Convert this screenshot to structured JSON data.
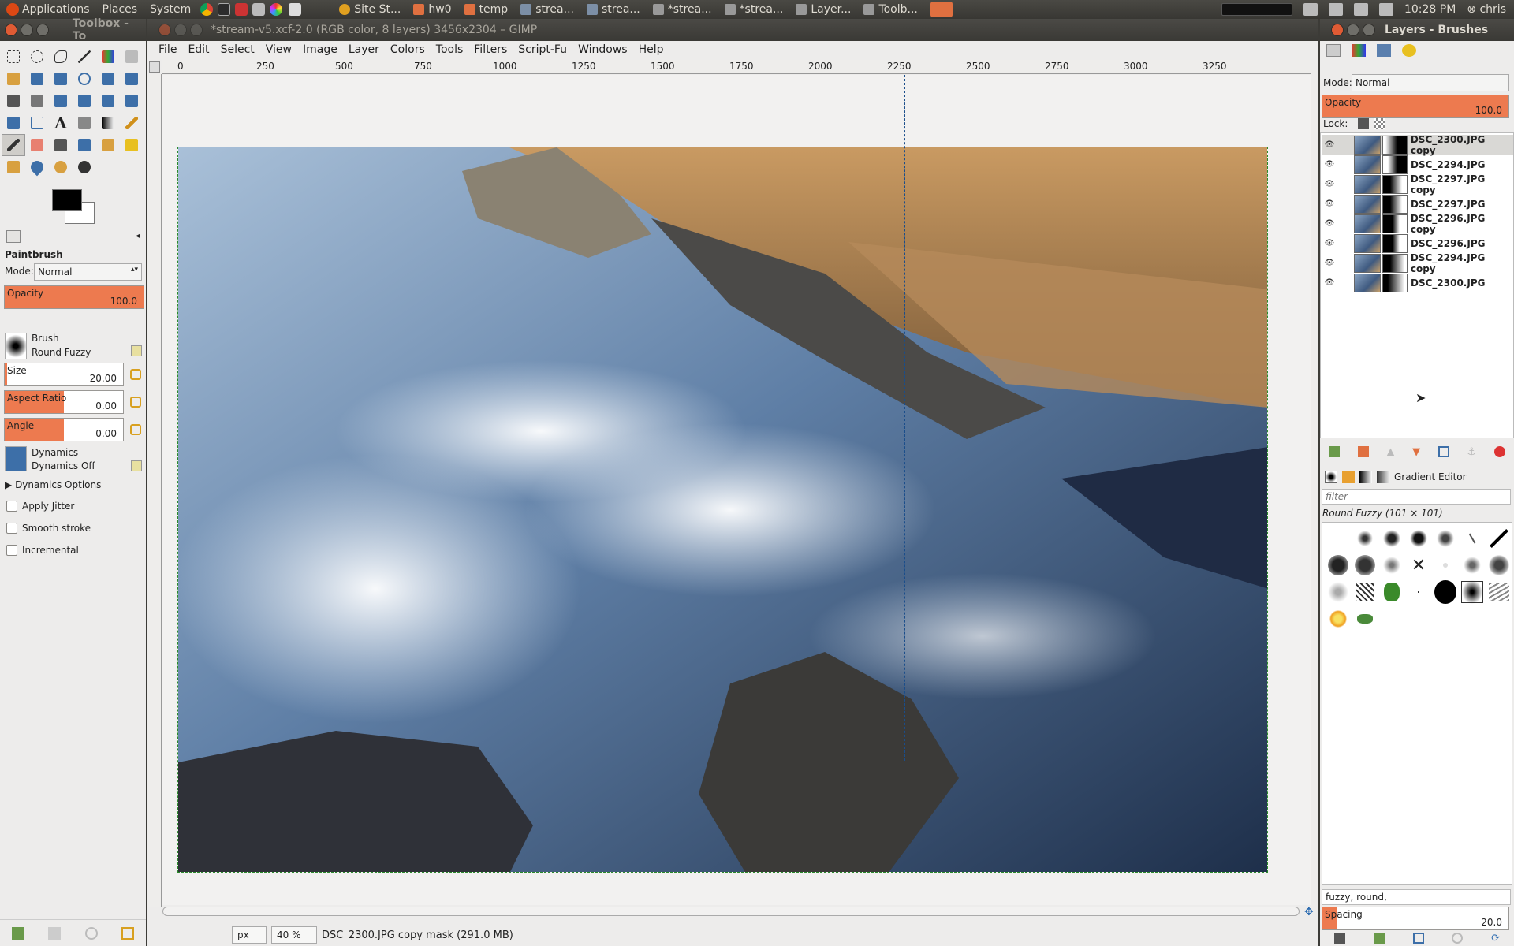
{
  "top_panel": {
    "menus": [
      "Applications",
      "Places",
      "System"
    ],
    "tasks": [
      "Site St...",
      "hw0",
      "temp",
      "strea...",
      "strea...",
      "*strea...",
      "*strea...",
      "Layer...",
      "Toolb..."
    ],
    "clock": "10:28 PM",
    "user": "chris"
  },
  "toolbox": {
    "title": "Toolbox - To",
    "tool_name": "Paintbrush",
    "mode_label": "Mode:",
    "mode_value": "Normal",
    "opacity_label": "Opacity",
    "opacity_value": "100.0",
    "brush_label": "Brush",
    "brush_value": "Round Fuzzy",
    "size_label": "Size",
    "size_value": "20.00",
    "aspect_label": "Aspect Ratio",
    "aspect_value": "0.00",
    "angle_label": "Angle",
    "angle_value": "0.00",
    "dynamics_label": "Dynamics",
    "dynamics_value": "Dynamics Off",
    "dynamics_options": "Dynamics Options",
    "apply_jitter": "Apply Jitter",
    "smooth_stroke": "Smooth stroke",
    "incremental": "Incremental"
  },
  "image_window": {
    "title": "*stream-v5.xcf-2.0 (RGB color, 8 layers) 3456x2304 – GIMP",
    "menus": [
      "File",
      "Edit",
      "Select",
      "View",
      "Image",
      "Layer",
      "Colors",
      "Tools",
      "Filters",
      "Script-Fu",
      "Windows",
      "Help"
    ],
    "ruler_ticks": [
      "0",
      "250",
      "500",
      "750",
      "1000",
      "1250",
      "1500",
      "1750",
      "2000",
      "2250",
      "2500",
      "2750",
      "3000",
      "3250"
    ],
    "unit": "px",
    "zoom": "40 %",
    "status": "DSC_2300.JPG copy mask (291.0 MB)"
  },
  "layers_panel": {
    "title": "Layers - Brushes",
    "mode_label": "Mode:",
    "mode_value": "Normal",
    "opacity_label": "Opacity",
    "opacity_value": "100.0",
    "lock_label": "Lock:",
    "layers": [
      "DSC_2300.JPG copy",
      "DSC_2294.JPG",
      "DSC_2297.JPG copy",
      "DSC_2297.JPG",
      "DSC_2296.JPG copy",
      "DSC_2296.JPG",
      "DSC_2294.JPG copy",
      "DSC_2300.JPG"
    ]
  },
  "brushes_panel": {
    "tab_label": "Gradient Editor",
    "filter_placeholder": "filter",
    "selected_brush": "Round Fuzzy (101 × 101)",
    "tags": "fuzzy, round,",
    "spacing_label": "Spacing",
    "spacing_value": "20.0"
  }
}
